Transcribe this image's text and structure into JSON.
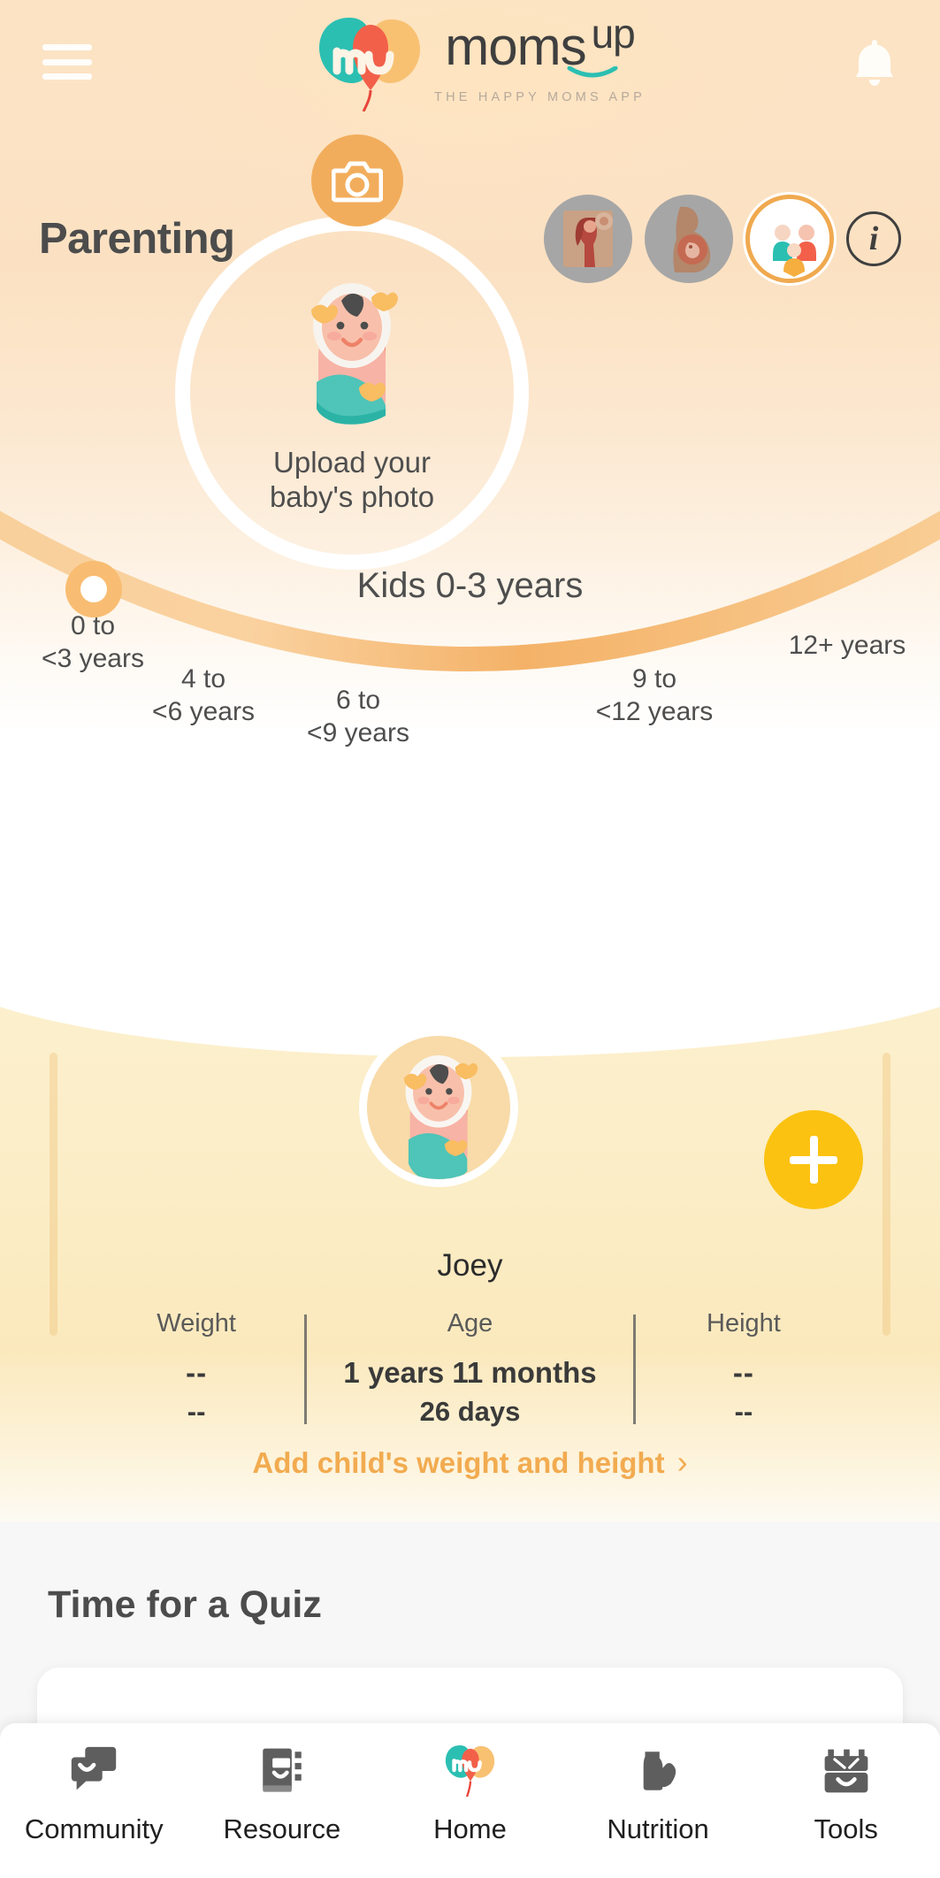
{
  "header": {
    "menu_icon": "hamburger-menu-icon",
    "brand_name": "moms",
    "brand_name_suffix": "up",
    "brand_tagline": "THE HAPPY MOMS APP",
    "notification_icon": "bell-icon"
  },
  "page": {
    "title": "Parenting",
    "info_glyph": "i",
    "stages": [
      {
        "name": "trying-to-conceive",
        "active": false
      },
      {
        "name": "pregnancy",
        "active": false
      },
      {
        "name": "parenting",
        "active": true
      }
    ]
  },
  "upload": {
    "line1": "Upload your",
    "line2": "baby's photo",
    "camera_icon": "camera-icon"
  },
  "age_selector": {
    "current_label": "Kids 0-3 years",
    "ticks": [
      {
        "line1": "0 to",
        "line2": "<3 years",
        "selected": true
      },
      {
        "line1": "4 to",
        "line2": "<6 years",
        "selected": false
      },
      {
        "line1": "6 to",
        "line2": "<9 years",
        "selected": false
      },
      {
        "line1": "9 to",
        "line2": "<12 years",
        "selected": false
      },
      {
        "line1": "12+ years",
        "line2": "",
        "selected": false
      }
    ]
  },
  "child": {
    "name": "Joey",
    "add_button_icon": "plus-icon",
    "metrics": [
      {
        "label": "Weight",
        "value": "--",
        "sub": "--"
      },
      {
        "label": "Age",
        "value": "1 years 11 months",
        "sub": "26 days"
      },
      {
        "label": "Height",
        "value": "--",
        "sub": "--"
      }
    ],
    "add_link": "Add child's weight and height",
    "add_link_chevron": "›"
  },
  "quiz": {
    "title": "Time for a Quiz",
    "card_text": "...  ..  ...  ..  .  .. ..."
  },
  "bottom_nav": [
    {
      "label": "Community",
      "icon": "chat-bubbles-icon",
      "active": false
    },
    {
      "label": "Resource",
      "icon": "book-icon",
      "active": false
    },
    {
      "label": "Home",
      "icon": "momsup-logo-icon",
      "active": true
    },
    {
      "label": "Nutrition",
      "icon": "food-icon",
      "active": false
    },
    {
      "label": "Tools",
      "icon": "toolbox-icon",
      "active": false
    }
  ],
  "colors": {
    "accent_orange": "#f2ad5c",
    "accent_yellow": "#fcc211",
    "brand_teal": "#26bfb4",
    "brand_coral": "#f2604a",
    "brand_peach": "#f7bb6b",
    "cream_card": "#fbeabf",
    "text_dark": "#4c4c4c"
  }
}
